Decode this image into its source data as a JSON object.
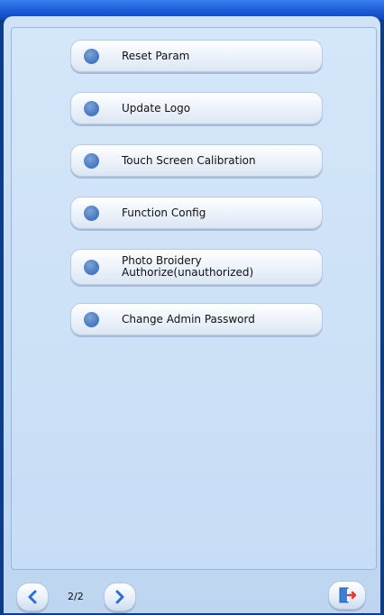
{
  "menu": {
    "items": [
      {
        "label": "Reset Param"
      },
      {
        "label": "Update Logo"
      },
      {
        "label": "Touch Screen Calibration"
      },
      {
        "label": "Function Config"
      },
      {
        "label": "Photo Broidery Authorize(unauthorized)"
      },
      {
        "label": "Change Admin Password"
      }
    ]
  },
  "footer": {
    "page_indicator": "2/2",
    "prev_icon": "chevron-left-icon",
    "next_icon": "chevron-right-icon",
    "exit_icon": "exit-door-icon"
  },
  "colors": {
    "titlebar": "#1b5bd6",
    "background": "#c7ddf5",
    "dot": "#4e7fc4",
    "arrow": "#2a6fd6",
    "exit_red": "#e23b2e"
  }
}
